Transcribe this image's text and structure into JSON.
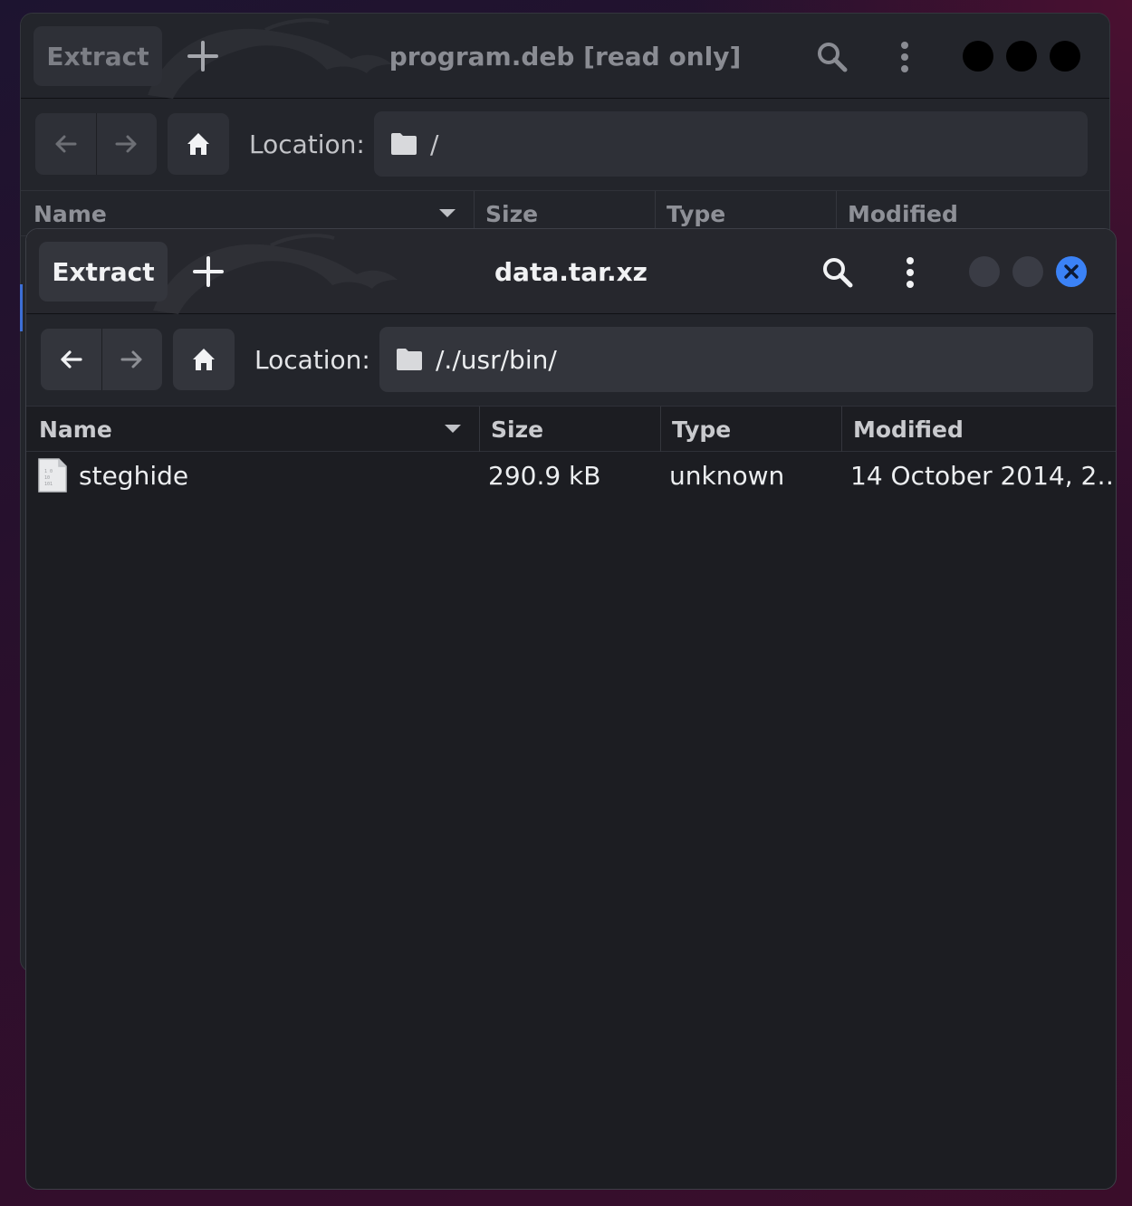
{
  "back_window": {
    "extract_label": "Extract",
    "title": "program.deb [read only]",
    "location_label": "Location:",
    "location_path": "/",
    "columns": {
      "name": "Name",
      "size": "Size",
      "type": "Type",
      "modified": "Modified"
    }
  },
  "front_window": {
    "extract_label": "Extract",
    "title": "data.tar.xz",
    "location_label": "Location:",
    "location_path": "/./usr/bin/",
    "columns": {
      "name": "Name",
      "size": "Size",
      "type": "Type",
      "modified": "Modified"
    },
    "files": [
      {
        "name": "steghide",
        "size": "290.9 kB",
        "type": "unknown",
        "modified": "14 October 2014, 2…"
      }
    ]
  },
  "icons": {
    "new": "plus-icon",
    "search": "search-icon",
    "menu": "kebab-menu-icon",
    "back": "arrow-left-icon",
    "forward": "arrow-right-icon",
    "home": "home-icon",
    "folder": "folder-icon",
    "file": "file-icon",
    "close": "close-icon"
  },
  "colors": {
    "close_button": "#3b82f6",
    "front_bg": "#1c1d22",
    "back_bg": "#23252b"
  }
}
